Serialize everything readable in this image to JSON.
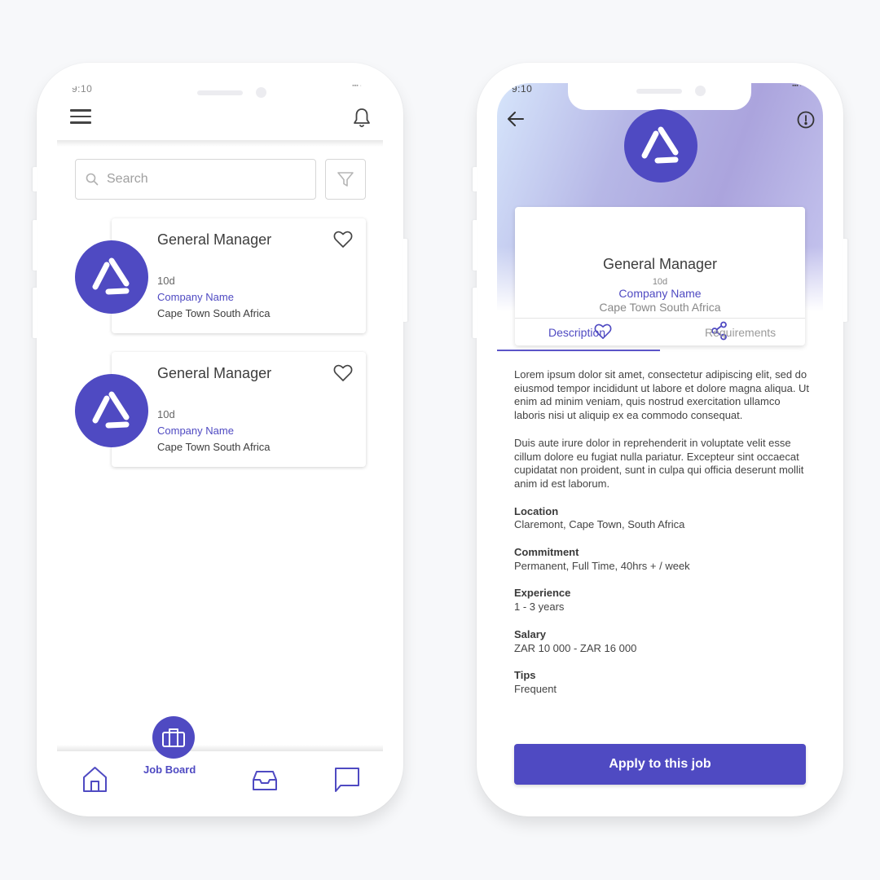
{
  "colors": {
    "accent": "#4f4ac2",
    "background": "#f7f8fa",
    "text": "#3d3d3d",
    "muted": "#9a9a9a"
  },
  "status_bar": {
    "time": "9:10"
  },
  "job_board": {
    "header": {
      "menu_icon": "hamburger-menu-icon",
      "notification_icon": "bell-icon"
    },
    "search": {
      "placeholder": "Search",
      "value": "",
      "icon": "search-icon",
      "filter_icon": "filter-funnel-icon"
    },
    "jobs": [
      {
        "title": "General Manager",
        "age": "10d",
        "company": "Company Name",
        "location": "Cape Town South Africa",
        "favorite_icon": "heart-outline-icon"
      },
      {
        "title": "General Manager",
        "age": "10d",
        "company": "Company Name",
        "location": "Cape Town South Africa",
        "favorite_icon": "heart-outline-icon"
      }
    ],
    "bottom_nav": [
      {
        "id": "home",
        "icon": "home-icon",
        "label": ""
      },
      {
        "id": "job-board",
        "icon": "briefcase-icon",
        "label": "Job Board",
        "active": true
      },
      {
        "id": "inbox",
        "icon": "inbox-tray-icon",
        "label": ""
      },
      {
        "id": "messages",
        "icon": "chat-bubble-icon",
        "label": ""
      }
    ]
  },
  "job_detail": {
    "back_icon": "arrow-left-icon",
    "info_icon": "alert-circle-icon",
    "title": "General Manager",
    "age": "10d",
    "company": "Company Name",
    "location": "Cape Town South Africa",
    "tabs": [
      {
        "label": "Description",
        "active": true
      },
      {
        "label": "Requirements",
        "active": false
      }
    ],
    "description": [
      "Lorem ipsum dolor sit amet, consectetur adipiscing elit, sed do eiusmod tempor incididunt ut labore et dolore magna aliqua. Ut enim ad minim veniam, quis nostrud exercitation ullamco laboris nisi ut aliquip ex ea commodo consequat.",
      "Duis aute irure dolor in reprehenderit in voluptate velit esse cillum dolore eu fugiat nulla pariatur. Excepteur sint occaecat cupidatat non proident, sunt in culpa qui officia deserunt mollit anim id est laborum."
    ],
    "details": [
      {
        "label": "Location",
        "value": "Claremont, Cape Town, South Africa"
      },
      {
        "label": "Commitment",
        "value": "Permanent, Full Time, 40hrs + / week"
      },
      {
        "label": "Experience",
        "value": "1 - 3 years"
      },
      {
        "label": "Salary",
        "value": "ZAR 10 000 - ZAR 16 000"
      },
      {
        "label": "Tips",
        "value": "Frequent"
      }
    ],
    "apply_label": "Apply to this job"
  }
}
